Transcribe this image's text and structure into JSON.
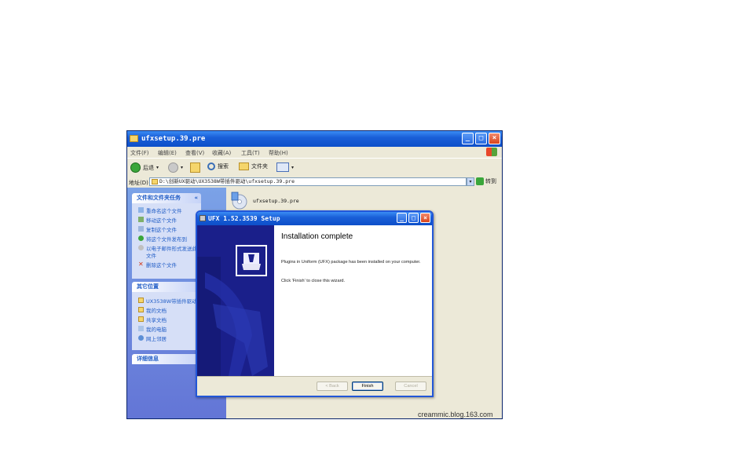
{
  "explorer": {
    "title": "ufxsetup.39.pre",
    "menu": [
      "文件(F)",
      "编辑(E)",
      "查看(V)",
      "收藏(A)",
      "工具(T)",
      "帮助(H)"
    ],
    "toolbar": {
      "back_label": "后退",
      "search_label": "搜索",
      "folders_label": "文件夹"
    },
    "address": {
      "label": "地址(D)",
      "value": "D:\\创新UX驱动\\UX3538W带插件驱动\\ufxsetup.39.pre",
      "go_label": "转到"
    },
    "file_tasks": {
      "header": "文件和文件夹任务",
      "items": [
        "重命名这个文件",
        "移动这个文件",
        "复制这个文件",
        "将这个文件发布到",
        "以电子邮件形式发送此",
        "文件",
        "删除这个文件"
      ]
    },
    "other_places": {
      "header": "其它位置",
      "items": [
        "UX3538W带插件驱动",
        "我的文档",
        "共享文档",
        "我的电脑",
        "网上邻居"
      ]
    },
    "details": {
      "header": "详细信息"
    },
    "file": {
      "name": "ufxsetup.39.pre"
    }
  },
  "setup": {
    "title": "UFX 1.52.3539 Setup",
    "heading": "Installation complete",
    "body": "Plugins in Uniform (UFX) package has been installed on your computer.",
    "note": "Click 'Finish' to close this wizard.",
    "back_label": "< Back",
    "finish_label": "Finish",
    "cancel_label": "Cancel"
  },
  "watermark": "creammic.blog.163.com",
  "colors": {
    "titlebar": "#0d4fc9",
    "taskpane": "#6f8ede",
    "setup_side": "#1a1f8a"
  }
}
